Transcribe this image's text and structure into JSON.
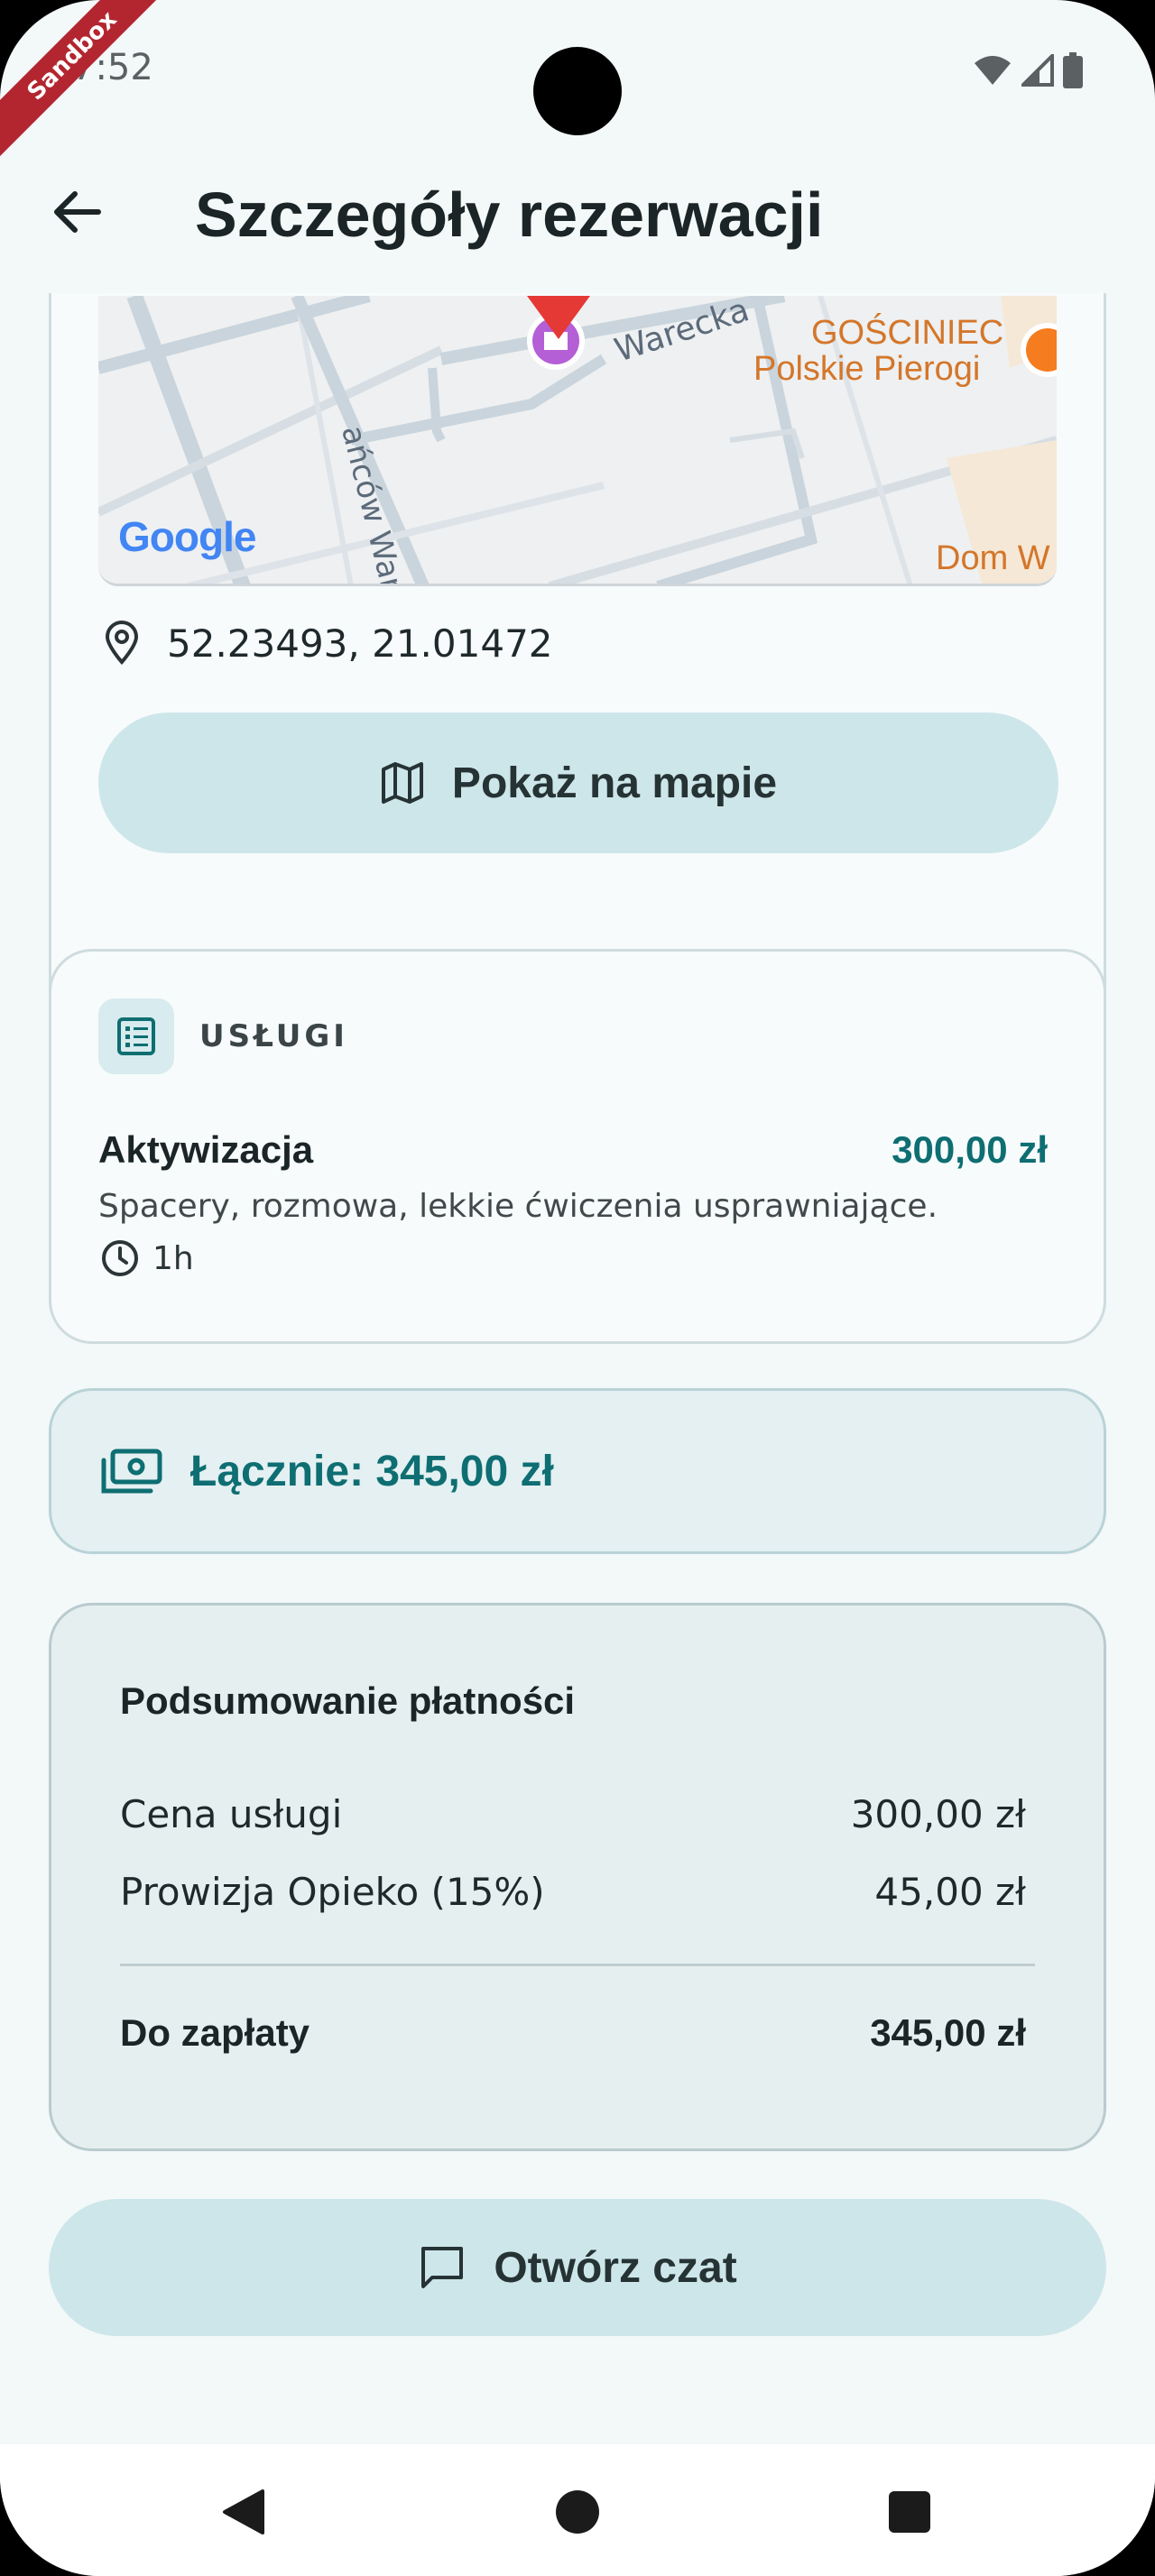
{
  "status_bar": {
    "time": "7:52",
    "sandbox_label": "Sandbox"
  },
  "app_bar": {
    "title": "Szczegóły rezerwacji"
  },
  "map": {
    "labels": {
      "street_1": "Warecka",
      "street_2": "ańców Warszawy",
      "poi_name_1": "GOŚCINIEC",
      "poi_name_2": "Polskie Pierogi",
      "poi_name_3": "Dom W",
      "brand": "Google"
    },
    "coordinates": "52.23493, 21.01472",
    "show_map_label": "Pokaż na mapie"
  },
  "services": {
    "section_label": "USŁUGI",
    "items": [
      {
        "name": "Aktywizacja",
        "price": "300,00 zł",
        "description": "Spacery, rozmowa, lekkie ćwiczenia usprawniające.",
        "duration": "1h"
      }
    ]
  },
  "total": {
    "label": "Łącznie: 345,00 zł"
  },
  "payment_summary": {
    "title": "Podsumowanie płatności",
    "service_price_label": "Cena usługi",
    "service_price_value": "300,00 zł",
    "commission_label": "Prowizja Opieko (15%)",
    "commission_value": "45,00 zł",
    "to_pay_label": "Do zapłaty",
    "to_pay_value": "345,00 zł"
  },
  "chat_button": {
    "label": "Otwórz czat"
  },
  "colors": {
    "accent": "#0e6e72",
    "button_bg": "#cde6ea",
    "background": "#f3f8f9",
    "map_pin": "#e53935",
    "poi_purple": "#b45fd6",
    "poi_orange": "#f57c1f"
  },
  "icons": {
    "back": "arrow-left-icon",
    "location": "map-pin-icon",
    "map": "map-icon",
    "services": "list-document-icon",
    "clock": "clock-icon",
    "money": "banknote-icon",
    "chat": "chat-bubble-icon"
  }
}
